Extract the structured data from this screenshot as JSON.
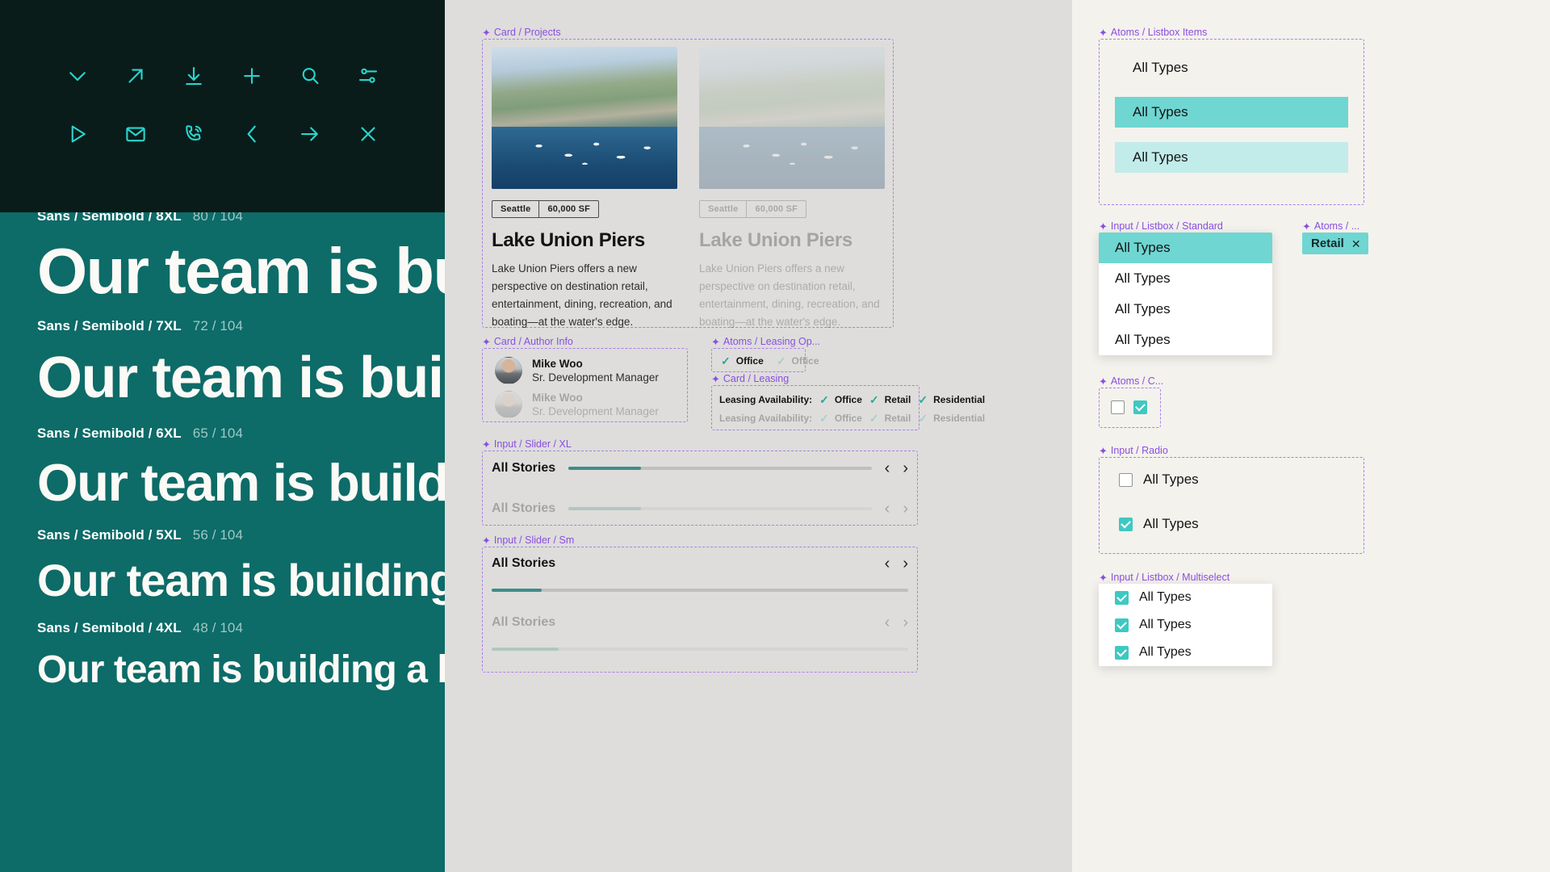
{
  "icons": {
    "row1": [
      "chevron-down-icon",
      "arrow-up-right-icon",
      "download-icon",
      "plus-icon",
      "search-icon",
      "filter-sliders-icon"
    ],
    "row2": [
      "play-icon",
      "mail-icon",
      "phone-call-icon",
      "chevron-left-icon",
      "arrow-right-icon",
      "close-icon"
    ]
  },
  "typography": {
    "rows": [
      {
        "meta": "Sans / Semibold / 8XL",
        "nums": "80 / 104",
        "size": 80,
        "sample": "Our team is building a b"
      },
      {
        "meta": "Sans / Semibold / 7XL",
        "nums": "72 / 104",
        "size": 72,
        "sample": "Our team is building a b"
      },
      {
        "meta": "Sans / Semibold / 6XL",
        "nums": "65 / 104",
        "size": 65,
        "sample": "Our team is building a b"
      },
      {
        "meta": "Sans / Semibold / 5XL",
        "nums": "56 / 104",
        "size": 56,
        "sample": "Our team is building a b"
      },
      {
        "meta": "Sans / Semibold / 4XL",
        "nums": "48 / 104",
        "size": 48,
        "sample": "Our team is building a b"
      }
    ]
  },
  "frames": {
    "card_projects": "Card / Projects",
    "card_author_info": "Card / Author Info",
    "atoms_leasing_op": "Atoms / Leasing Op...",
    "card_leasing": "Card / Leasing",
    "input_slider_xl": "Input / Slider / XL",
    "input_slider_sm": "Input / Slider / Sm",
    "atoms_listbox_items": "Atoms / Listbox Items",
    "input_listbox_standard": "Input / Listbox / Standard",
    "atoms_chip": "Atoms / ...",
    "atoms_checkbox": "Atoms / C...",
    "input_radio": "Input / Radio",
    "input_listbox_multiselect": "Input / Listbox / Multiselect"
  },
  "project_card": {
    "tags": [
      "Seattle",
      "60,000 SF"
    ],
    "title": "Lake Union Piers",
    "description": "Lake Union Piers offers a new perspective on destination retail, entertainment, dining, recreation, and boating—at the water's edge."
  },
  "author": {
    "name": "Mike Woo",
    "title": "Sr. Development Manager"
  },
  "leasing": {
    "atoms_option": "Office",
    "atoms_option_ghost": "Office",
    "heading": "Leasing Availability:",
    "options": [
      "Office",
      "Retail",
      "Residential"
    ]
  },
  "sliders": {
    "xl_label": "All Stories",
    "sm_label": "All Stories",
    "xl_fill_percent": 24,
    "sm_fill_percent": 12,
    "prev_icon": "chevron-left-icon",
    "next_icon": "chevron-right-icon"
  },
  "listbox_items": {
    "items": [
      {
        "label": "All Types",
        "state": "default"
      },
      {
        "label": "All Types",
        "state": "selected"
      },
      {
        "label": "All Types",
        "state": "hover"
      }
    ]
  },
  "listbox_standard": {
    "items": [
      {
        "label": "All Types",
        "state": "selected"
      },
      {
        "label": "All Types",
        "state": "default"
      },
      {
        "label": "All Types",
        "state": "default"
      },
      {
        "label": "All Types",
        "state": "default"
      }
    ]
  },
  "chip": {
    "label": "Retail",
    "close_icon": "close-icon"
  },
  "checkbox_atoms": [
    {
      "checked": false
    },
    {
      "checked": true
    }
  ],
  "radio": {
    "options": [
      {
        "label": "All Types",
        "checked": false
      },
      {
        "label": "All Types",
        "checked": true
      }
    ]
  },
  "multiselect": {
    "options": [
      {
        "label": "All Types",
        "checked": true
      },
      {
        "label": "All Types",
        "checked": true
      },
      {
        "label": "All Types",
        "checked": true
      }
    ]
  },
  "colors": {
    "icon_board_bg": "#0a1c1a",
    "icon_accent": "#2ad4cd",
    "type_board_bg": "#0d6b68",
    "middle_bg": "#dedddb",
    "right_bg": "#f4f2ed",
    "figma_purple": "#8a4fe0",
    "teal_selected": "#6fd6d2",
    "teal_hover": "#c2ecea",
    "slider_fill": "#3f8d89"
  }
}
